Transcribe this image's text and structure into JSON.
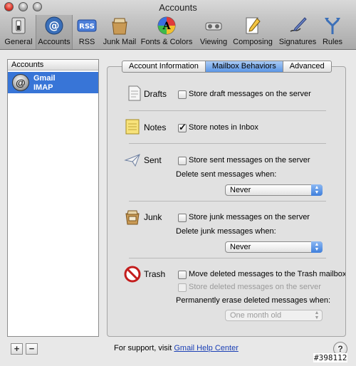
{
  "window": {
    "title": "Accounts"
  },
  "toolbar": {
    "items": [
      {
        "label": "General",
        "icon": "general-switch-icon"
      },
      {
        "label": "Accounts",
        "icon": "at-sign-icon"
      },
      {
        "label": "RSS",
        "icon": "rss-icon"
      },
      {
        "label": "Junk Mail",
        "icon": "junk-mail-icon"
      },
      {
        "label": "Fonts & Colors",
        "icon": "fonts-colors-icon"
      },
      {
        "label": "Viewing",
        "icon": "viewing-icon"
      },
      {
        "label": "Composing",
        "icon": "composing-icon"
      },
      {
        "label": "Signatures",
        "icon": "signatures-icon"
      },
      {
        "label": "Rules",
        "icon": "rules-icon"
      }
    ],
    "selected": "Accounts"
  },
  "accounts": {
    "header": "Accounts",
    "items": [
      {
        "name": "Gmail",
        "type": "IMAP"
      }
    ],
    "add_label": "+",
    "remove_label": "−"
  },
  "tabs": [
    {
      "label": "Account Information"
    },
    {
      "label": "Mailbox Behaviors"
    },
    {
      "label": "Advanced"
    }
  ],
  "active_tab": "Mailbox Behaviors",
  "sections": {
    "drafts": {
      "title": "Drafts",
      "option": "Store draft messages on the server",
      "checked": false
    },
    "notes": {
      "title": "Notes",
      "option": "Store notes in Inbox",
      "checked": true
    },
    "sent": {
      "title": "Sent",
      "option": "Store sent messages on the server",
      "checked": false,
      "delete_label": "Delete sent messages when:",
      "delete_value": "Never"
    },
    "junk": {
      "title": "Junk",
      "option": "Store junk messages on the server",
      "checked": false,
      "delete_label": "Delete junk messages when:",
      "delete_value": "Never"
    },
    "trash": {
      "title": "Trash",
      "option": "Move deleted messages to the Trash mailbox",
      "checked": false,
      "sub_option": "Store deleted messages on the server",
      "erase_label": "Permanently erase deleted messages when:",
      "erase_value": "One month old"
    }
  },
  "footer": {
    "support_text": "For support, visit",
    "support_link": "Gmail Help Center",
    "help_label": "?"
  },
  "watermark": "#398112"
}
